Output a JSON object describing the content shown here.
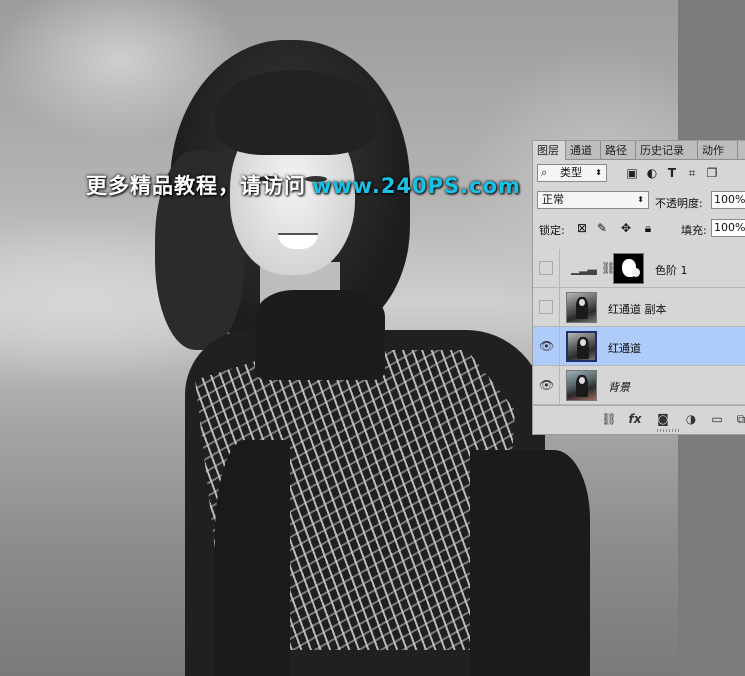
{
  "watermark": {
    "text_cn": "更多精品教程，请访问",
    "text_url": "www.240PS.com",
    "url_color": "#17c2e6"
  },
  "layers_panel": {
    "tabs": [
      "图层",
      "通道",
      "路径",
      "历史记录",
      "动作"
    ],
    "active_tab": "图层",
    "filter": {
      "kind_label": "类型",
      "icons": [
        "image-filter-icon",
        "adjustment-filter-icon",
        "type-filter-icon",
        "shape-filter-icon",
        "smart-object-filter-icon"
      ]
    },
    "blend_mode": "正常",
    "opacity_label": "不透明度:",
    "opacity_value": "100%",
    "lock_label": "锁定:",
    "lock_icons": [
      "lock-transparent-icon",
      "lock-paint-icon",
      "lock-position-icon",
      "lock-all-icon"
    ],
    "fill_label": "填充:",
    "fill_value": "100%",
    "layers": [
      {
        "name": "色阶 1",
        "visible": false,
        "selected": false,
        "type": "adjustment-levels",
        "has_mask": true
      },
      {
        "name": "红通道 副本",
        "visible": false,
        "selected": false,
        "type": "pixel"
      },
      {
        "name": "红通道",
        "visible": true,
        "selected": true,
        "type": "pixel"
      },
      {
        "name": "背景",
        "visible": true,
        "selected": false,
        "type": "background",
        "italic": true
      }
    ],
    "bottom_icons": [
      "link-layers-icon",
      "fx-icon",
      "add-mask-icon",
      "adjustment-layer-icon",
      "new-group-icon",
      "new-layer-icon"
    ],
    "selection_color": "#aecbfa"
  }
}
